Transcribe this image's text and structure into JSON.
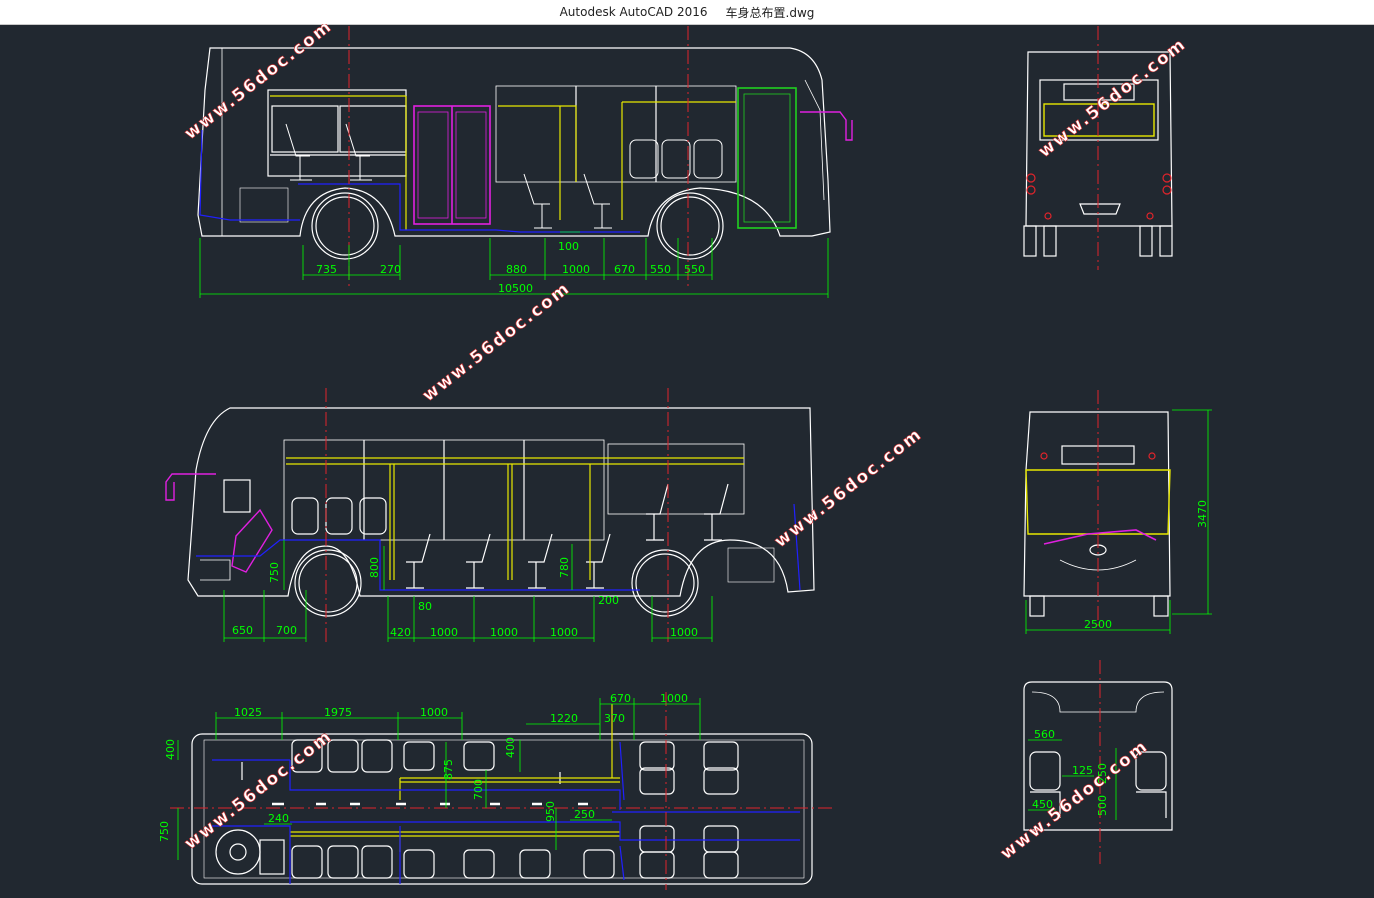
{
  "window": {
    "app": "Autodesk AutoCAD 2016",
    "file": "车身总布置.dwg"
  },
  "watermark": "www.56doc.com",
  "colors": {
    "background": "#212830",
    "outline": "#ffffff",
    "dimension": "#00ff00",
    "center": "#e0242b",
    "seats_yellow": "#e8e800",
    "door_magenta": "#e020e0",
    "door_green": "#20d020",
    "floor_blue": "#2020ff"
  },
  "side_right": {
    "dims": [
      "735",
      "270",
      "100",
      "880",
      "1000",
      "670",
      "550",
      "550",
      "10500"
    ]
  },
  "side_left": {
    "dims": [
      "750",
      "800",
      "780",
      "80",
      "200",
      "650",
      "700",
      "420",
      "1000",
      "1000",
      "1000",
      "1000"
    ]
  },
  "plan": {
    "dims": [
      "1025",
      "1975",
      "1000",
      "1220",
      "370",
      "670",
      "1000",
      "400",
      "400",
      "875",
      "700",
      "950",
      "250",
      "240",
      "750"
    ]
  },
  "rear_view": {
    "dims": []
  },
  "front_view": {
    "dims": [
      "3470",
      "2500"
    ]
  },
  "section_view": {
    "dims": [
      "560",
      "125",
      "250",
      "450",
      "500"
    ]
  }
}
